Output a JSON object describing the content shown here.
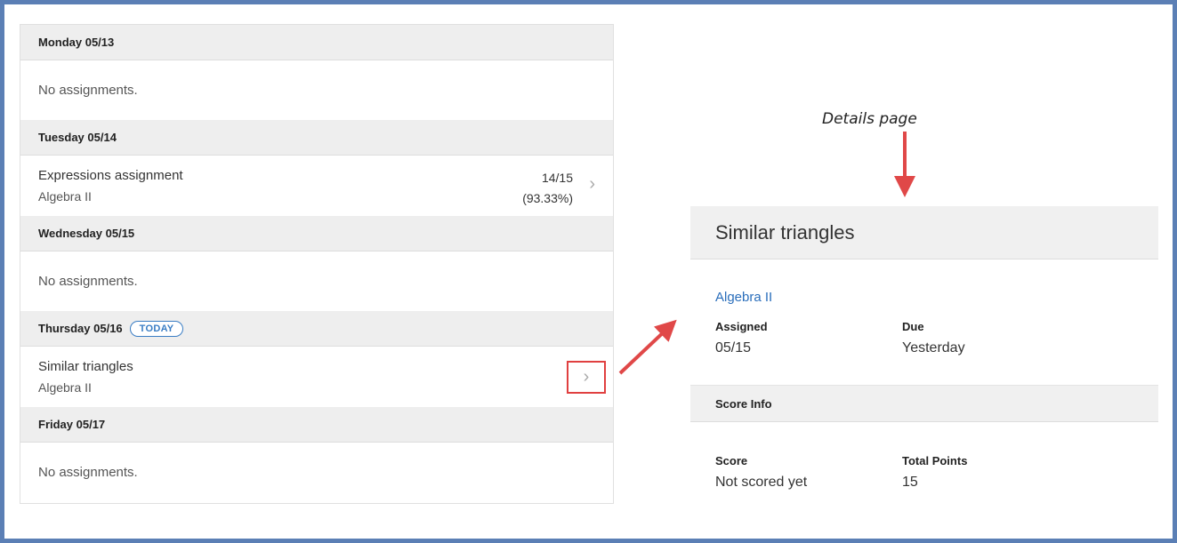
{
  "list": {
    "days": [
      {
        "header": "Monday 05/13",
        "empty_text": "No assignments."
      },
      {
        "header": "Tuesday 05/14",
        "assignment": {
          "name": "Expressions assignment",
          "course": "Algebra II",
          "score": "14/15",
          "percent": "(93.33%)"
        }
      },
      {
        "header": "Wednesday 05/15",
        "empty_text": "No assignments."
      },
      {
        "header": "Thursday 05/16",
        "badge": "TODAY",
        "assignment": {
          "name": "Similar triangles",
          "course": "Algebra II"
        }
      },
      {
        "header": "Friday 05/17",
        "empty_text": "No assignments."
      }
    ],
    "chevron_glyph": "›"
  },
  "annotation": {
    "label": "Details page",
    "color": "#e04848"
  },
  "details": {
    "title": "Similar triangles",
    "course": "Algebra II",
    "assigned_label": "Assigned",
    "assigned_value": "05/15",
    "due_label": "Due",
    "due_value": "Yesterday",
    "score_info_heading": "Score Info",
    "score_label": "Score",
    "score_value": "Not scored yet",
    "total_points_label": "Total Points",
    "total_points_value": "15"
  },
  "colors": {
    "frame_border": "#5b7fb5",
    "link": "#2a6ebb",
    "badge": "#3a7dc4",
    "highlight": "#e04040"
  }
}
